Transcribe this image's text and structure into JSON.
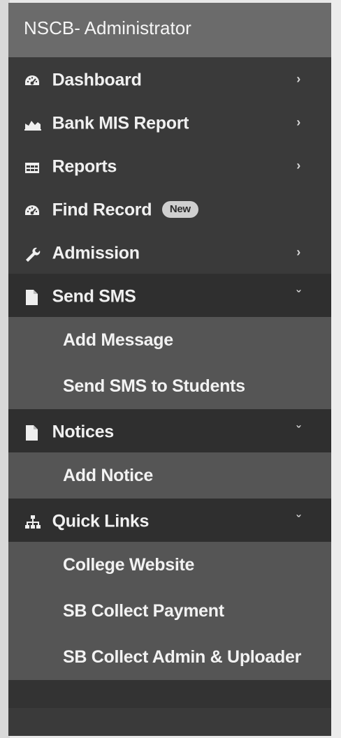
{
  "brand": {
    "title": "NSCB- Administrator"
  },
  "menu": {
    "dashboard": {
      "label": "Dashboard",
      "icon": "tachometer-icon"
    },
    "bank_mis": {
      "label": "Bank MIS Report",
      "icon": "area-chart-icon"
    },
    "reports": {
      "label": "Reports",
      "icon": "table-icon"
    },
    "find_record": {
      "label": "Find Record",
      "icon": "tachometer-icon",
      "badge": "New"
    },
    "admission": {
      "label": "Admission",
      "icon": "wrench-icon"
    },
    "send_sms": {
      "label": "Send SMS",
      "icon": "file-icon",
      "expanded": true,
      "items": [
        "Add Message",
        "Send SMS to Students"
      ]
    },
    "notices": {
      "label": "Notices",
      "icon": "file-icon",
      "expanded": true,
      "items": [
        "Add Notice"
      ]
    },
    "quick_links": {
      "label": "Quick Links",
      "icon": "sitemap-icon",
      "expanded": true,
      "items": [
        "College Website",
        "SB Collect Payment",
        "SB Collect Admin & Uploader"
      ]
    }
  },
  "colors": {
    "sidebar_bg": "#3a3a3a",
    "header_bg": "#6b6b6b",
    "submenu_bg": "#555555",
    "text": "#f0f0f0"
  }
}
